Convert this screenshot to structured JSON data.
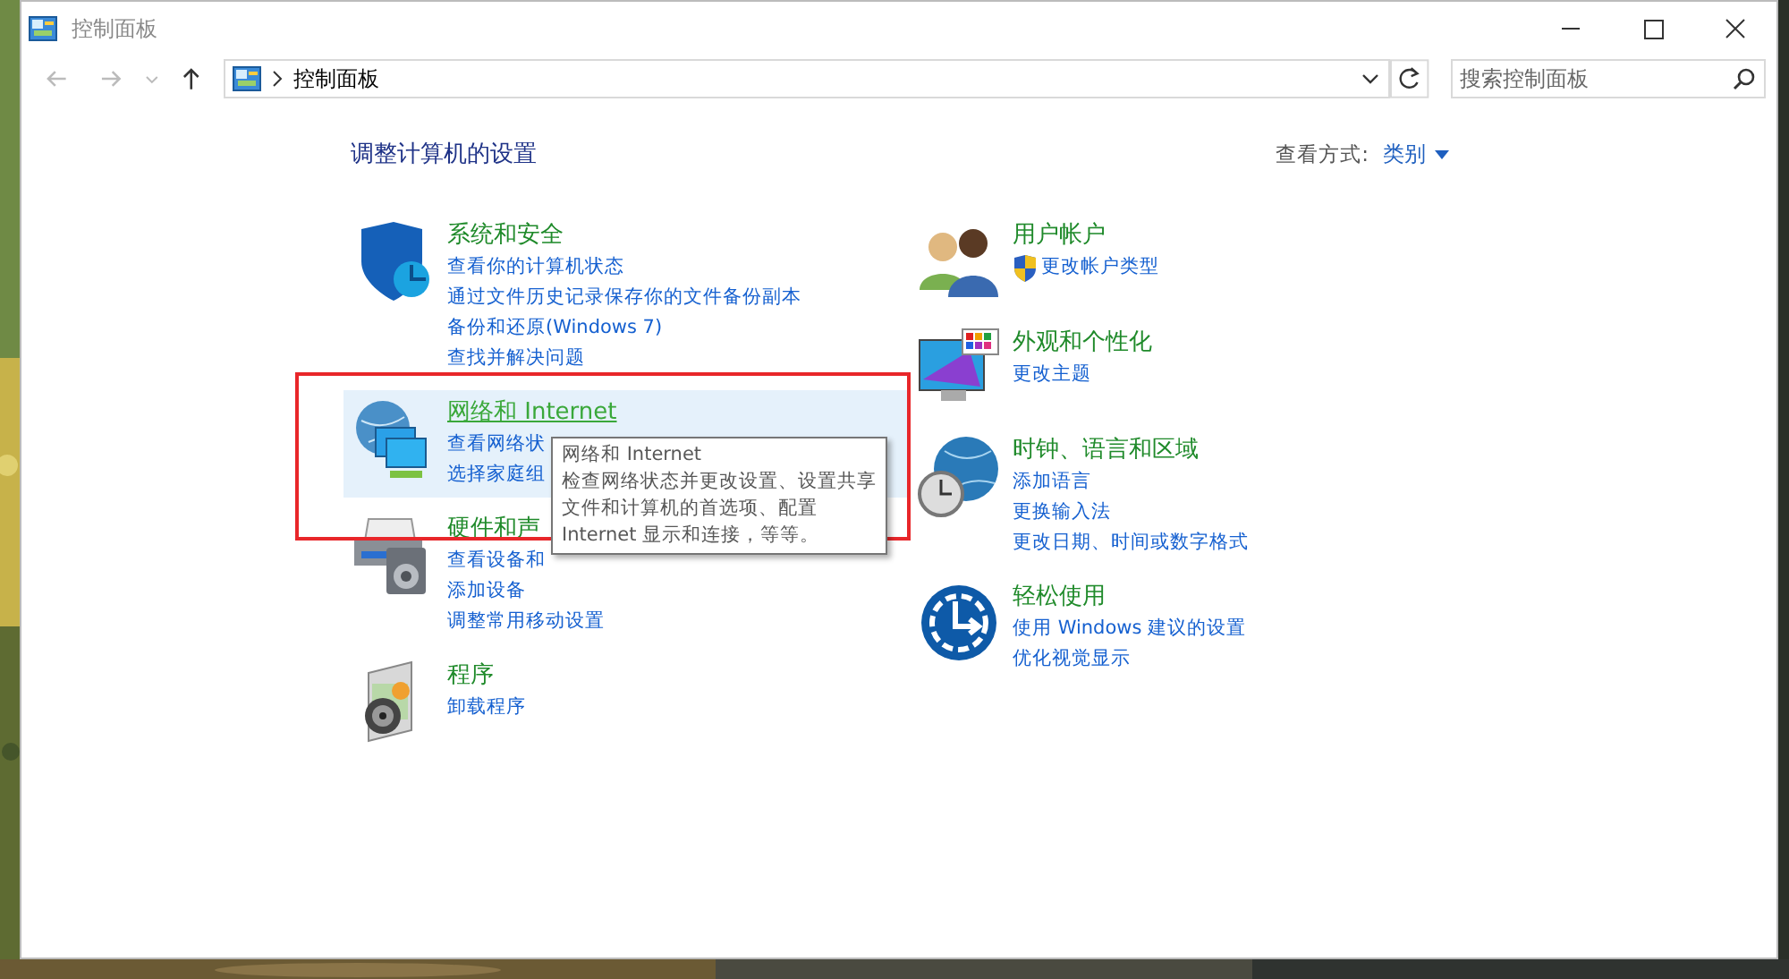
{
  "window": {
    "title": "控制面板"
  },
  "address_bar": {
    "path": "控制面板",
    "search_placeholder": "搜索控制面板"
  },
  "heading": "调整计算机的设置",
  "view_by": {
    "label": "查看方式:",
    "value": "类别"
  },
  "columns": [
    [
      {
        "title": "系统和安全",
        "kind": "shield",
        "hovered": false,
        "links": [
          {
            "text": "查看你的计算机状态",
            "kind": "plain"
          },
          {
            "text": "通过文件历史记录保存你的文件备份副本",
            "kind": "plain"
          },
          {
            "text": "备份和还原(Windows 7)",
            "kind": "plain"
          },
          {
            "text": "查找并解决问题",
            "kind": "plain"
          }
        ]
      },
      {
        "title": "网络和 Internet",
        "kind": "network",
        "hovered": true,
        "links": [
          {
            "text": "查看网络状",
            "kind": "plain"
          },
          {
            "text": "选择家庭组",
            "kind": "plain"
          }
        ]
      },
      {
        "title": "硬件和声",
        "kind": "printer",
        "hovered": false,
        "links": [
          {
            "text": "查看设备和",
            "kind": "plain"
          },
          {
            "text": "添加设备",
            "kind": "plain"
          },
          {
            "text": "调整常用移动设置",
            "kind": "plain"
          }
        ]
      },
      {
        "title": "程序",
        "kind": "software",
        "hovered": false,
        "links": [
          {
            "text": "卸载程序",
            "kind": "plain"
          }
        ]
      }
    ],
    [
      {
        "title": "用户帐户",
        "kind": "users",
        "hovered": false,
        "links": [
          {
            "text": "更改帐户类型",
            "kind": "admin"
          }
        ]
      },
      {
        "title": "外观和个性化",
        "kind": "appearance",
        "hovered": false,
        "links": [
          {
            "text": "更改主题",
            "kind": "plain"
          }
        ]
      },
      {
        "title": "时钟、语言和区域",
        "kind": "clock",
        "hovered": false,
        "links": [
          {
            "text": "添加语言",
            "kind": "plain"
          },
          {
            "text": "更换输入法",
            "kind": "plain"
          },
          {
            "text": "更改日期、时间或数字格式",
            "kind": "plain"
          }
        ]
      },
      {
        "title": "轻松使用",
        "kind": "ease",
        "hovered": false,
        "links": [
          {
            "text": "使用 Windows 建议的设置",
            "kind": "plain"
          },
          {
            "text": "优化视觉显示",
            "kind": "plain"
          }
        ]
      }
    ]
  ],
  "tooltip": {
    "title": "网络和 Internet",
    "lines": [
      "检查网络状态并更改设置、设置共享",
      "文件和计算机的首选项、配置",
      "Internet 显示和连接，等等。"
    ]
  },
  "annotation": {
    "kind": "highlight-frame"
  }
}
